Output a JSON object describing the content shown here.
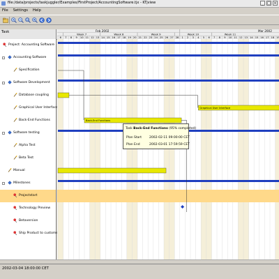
{
  "window": {
    "title": "file:/data/projects/taskjuggler/Examples/FirstProject/AccountingSoftware.tjx - KTjview"
  },
  "menu": [
    "File",
    "Settings",
    "Help"
  ],
  "task_header": "Task",
  "timeline": {
    "months": [
      {
        "label": "Feb 2002"
      },
      {
        "label": "Mar 2002"
      }
    ],
    "weeks": [
      {
        "label": "Week 7"
      },
      {
        "label": "Week 8"
      },
      {
        "label": "Week 9"
      },
      {
        "label": "Week 10"
      },
      {
        "label": "Week 11"
      }
    ],
    "days": [
      "6",
      "7",
      "8",
      "9",
      "10",
      "11",
      "12",
      "13",
      "14",
      "15",
      "16",
      "17",
      "18",
      "19",
      "20",
      "21",
      "22",
      "23",
      "24",
      "25",
      "26",
      "27",
      "28",
      "1",
      "2",
      "3",
      "4",
      "5",
      "6",
      "7",
      "8",
      "9",
      "10",
      "11",
      "12",
      "13",
      "14",
      "15",
      "16",
      "17",
      "18",
      "19"
    ]
  },
  "tasks": [
    {
      "label": "Project: Accounting Software",
      "icon": "pin-icon",
      "level": 0
    },
    {
      "label": "Accounting Software",
      "icon": "group-icon",
      "level": 1
    },
    {
      "label": "Specification",
      "icon": "task-icon",
      "level": 2
    },
    {
      "label": "Software Development",
      "icon": "group-icon",
      "level": 1
    },
    {
      "label": "Database coupling",
      "icon": "task-icon",
      "level": 2
    },
    {
      "label": "Graphical User Interface",
      "icon": "task-icon",
      "level": 2
    },
    {
      "label": "Back-End Functions",
      "icon": "task-icon",
      "level": 2
    },
    {
      "label": "Software testing",
      "icon": "group-icon",
      "level": 1
    },
    {
      "label": "Alpha Test",
      "icon": "task-icon",
      "level": 2
    },
    {
      "label": "Beta Test",
      "icon": "task-icon",
      "level": 2
    },
    {
      "label": "Manual",
      "icon": "task-icon",
      "level": 1
    },
    {
      "label": "Milestones",
      "icon": "group-icon",
      "level": 1
    },
    {
      "label": "Projectstart",
      "icon": "pin-icon",
      "level": 2
    },
    {
      "label": "Technology Preview",
      "icon": "pin-icon",
      "level": 2
    },
    {
      "label": "Betaversion",
      "icon": "pin-icon",
      "level": 2
    },
    {
      "label": "Ship Product to customer",
      "icon": "pin-icon",
      "level": 2
    }
  ],
  "bar_labels": {
    "back_end": "Back-End Functions",
    "gui": "Graphical User Interface"
  },
  "tooltip": {
    "prefix": "Task",
    "task": "Back-End Functions",
    "suffix": "(95% completed)",
    "rows": [
      {
        "label": "Plan Start",
        "value": "2002-02-11 09:00:00 CET"
      },
      {
        "label": "Plan End",
        "value": "2002-03-01 17:59:59 CET"
      }
    ]
  },
  "status": "2002-03-04 18:00:00 CET",
  "colors": {
    "group_bar": "#1f3fbf",
    "task_bar": "#e8e800",
    "weekend": "#f5efd9",
    "selected": "#ffd98a"
  }
}
